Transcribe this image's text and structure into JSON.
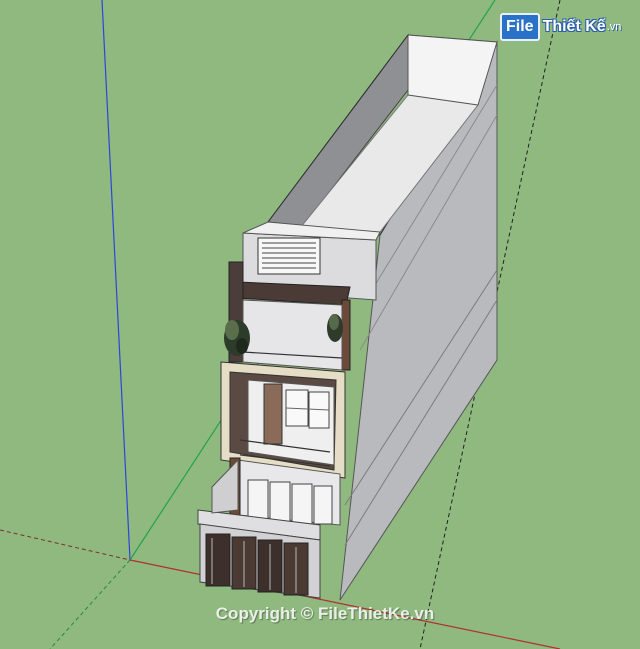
{
  "image": {
    "subject": "3D SketchUp model of a narrow multi-storey townhouse",
    "background_color": "#8fb97f"
  },
  "logo": {
    "badge": "File",
    "name": "Thiết Kế",
    "tld": ".vn"
  },
  "watermark": {
    "text": "Copyright © FileThietKe.vn"
  }
}
